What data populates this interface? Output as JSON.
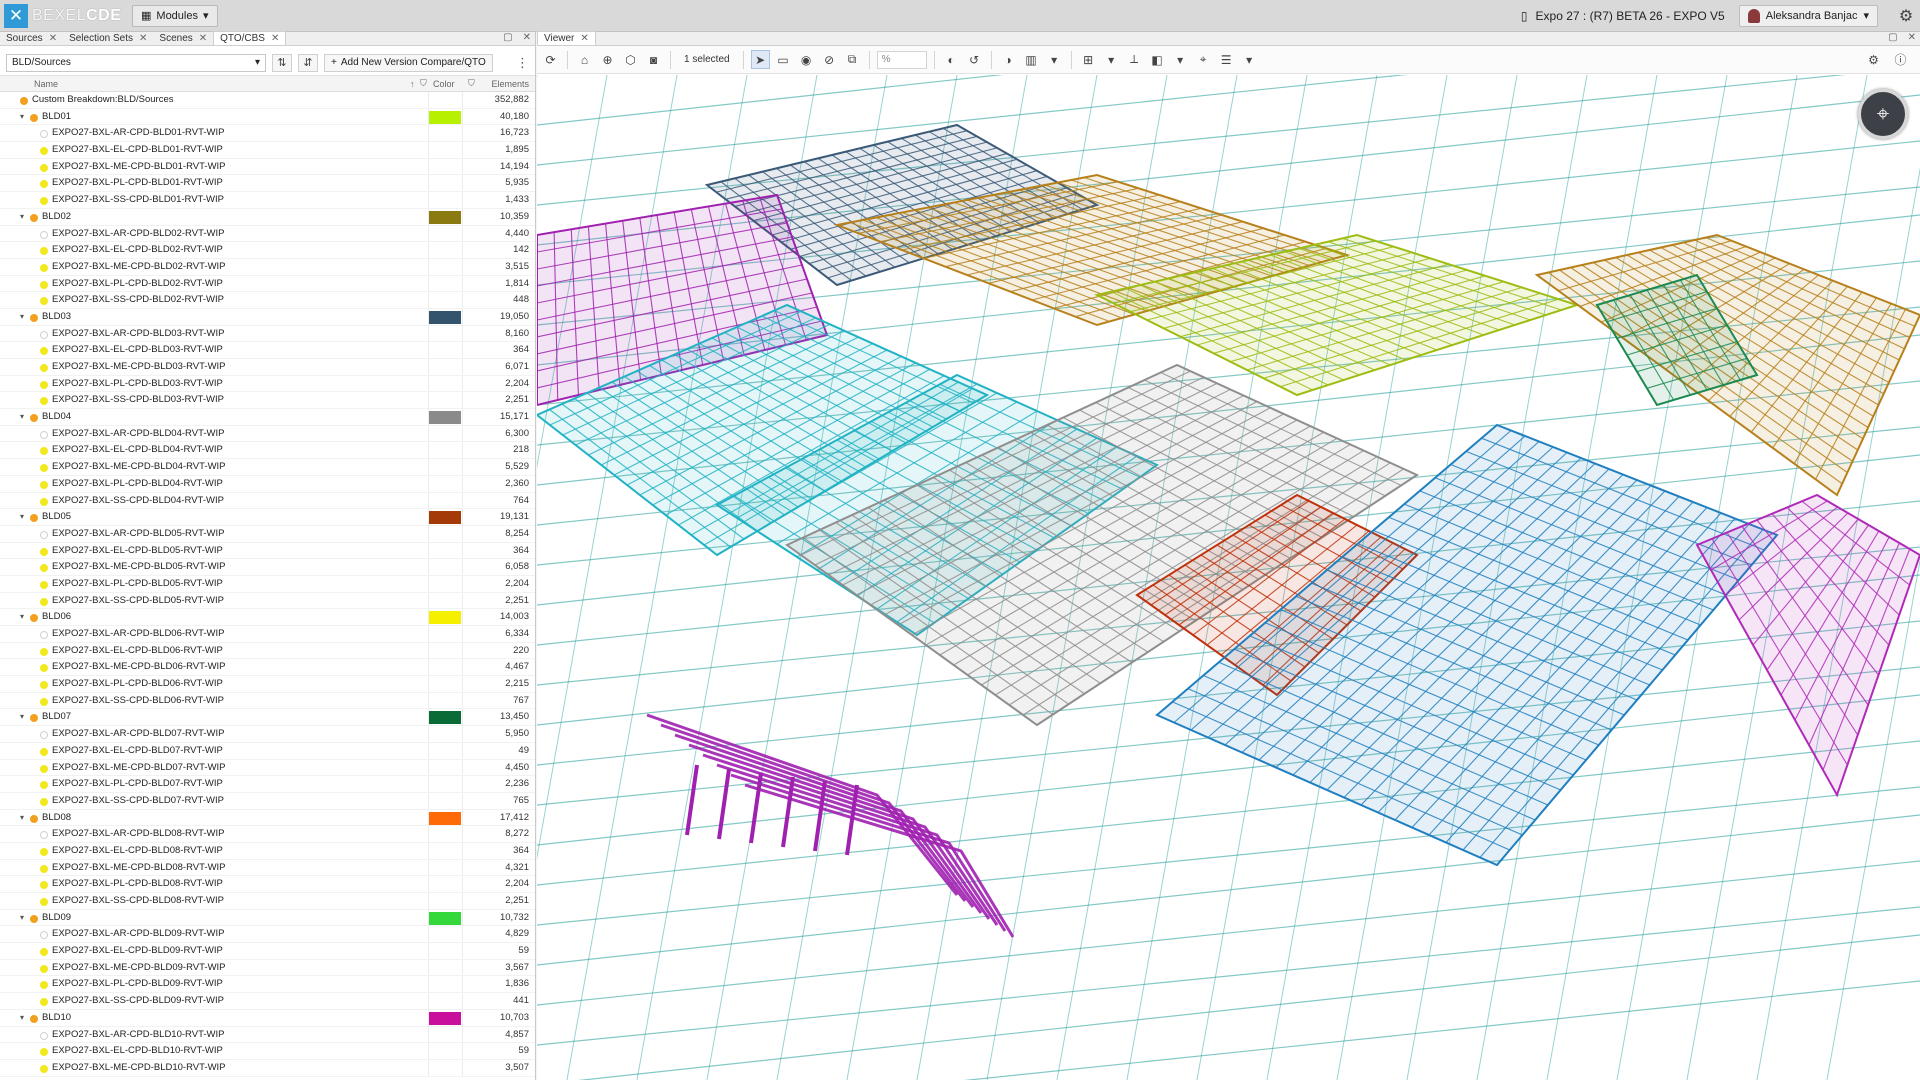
{
  "app": {
    "brand_prefix": "BEXEL",
    "brand_suffix": "CDE",
    "modules_label": "Modules"
  },
  "project": {
    "name": "Expo 27 : (R7) BETA 26 - EXPO V5"
  },
  "user": {
    "name": "Aleksandra Banjac"
  },
  "left_tabs": [
    {
      "label": "Sources"
    },
    {
      "label": "Selection Sets"
    },
    {
      "label": "Scenes"
    },
    {
      "label": "QTO/CBS"
    }
  ],
  "left_toolbar": {
    "breakdown_value": "BLD/Sources",
    "add_compare_label": "Add New Version Compare/QTO"
  },
  "columns": {
    "name": "Name",
    "color": "Color",
    "elements": "Elements"
  },
  "tree": {
    "root": {
      "label": "Custom Breakdown:BLD/Sources",
      "count": "352,882"
    },
    "groups": [
      {
        "label": "BLD01",
        "count": "40,180",
        "color": "#b7f000",
        "children": [
          {
            "label": "EXPO27-BXL-AR-CPD-BLD01-RVT-WIP",
            "count": "16,723"
          },
          {
            "label": "EXPO27-BXL-EL-CPD-BLD01-RVT-WIP",
            "count": "1,895"
          },
          {
            "label": "EXPO27-BXL-ME-CPD-BLD01-RVT-WIP",
            "count": "14,194"
          },
          {
            "label": "EXPO27-BXL-PL-CPD-BLD01-RVT-WIP",
            "count": "5,935"
          },
          {
            "label": "EXPO27-BXL-SS-CPD-BLD01-RVT-WIP",
            "count": "1,433"
          }
        ]
      },
      {
        "label": "BLD02",
        "count": "10,359",
        "color": "#8a7a10",
        "children": [
          {
            "label": "EXPO27-BXL-AR-CPD-BLD02-RVT-WIP",
            "count": "4,440"
          },
          {
            "label": "EXPO27-BXL-EL-CPD-BLD02-RVT-WIP",
            "count": "142"
          },
          {
            "label": "EXPO27-BXL-ME-CPD-BLD02-RVT-WIP",
            "count": "3,515"
          },
          {
            "label": "EXPO27-BXL-PL-CPD-BLD02-RVT-WIP",
            "count": "1,814"
          },
          {
            "label": "EXPO27-BXL-SS-CPD-BLD02-RVT-WIP",
            "count": "448"
          }
        ]
      },
      {
        "label": "BLD03",
        "count": "19,050",
        "color": "#34546e",
        "children": [
          {
            "label": "EXPO27-BXL-AR-CPD-BLD03-RVT-WIP",
            "count": "8,160"
          },
          {
            "label": "EXPO27-BXL-EL-CPD-BLD03-RVT-WIP",
            "count": "364"
          },
          {
            "label": "EXPO27-BXL-ME-CPD-BLD03-RVT-WIP",
            "count": "6,071"
          },
          {
            "label": "EXPO27-BXL-PL-CPD-BLD03-RVT-WIP",
            "count": "2,204"
          },
          {
            "label": "EXPO27-BXL-SS-CPD-BLD03-RVT-WIP",
            "count": "2,251"
          }
        ]
      },
      {
        "label": "BLD04",
        "count": "15,171",
        "color": "#8a8a8a",
        "children": [
          {
            "label": "EXPO27-BXL-AR-CPD-BLD04-RVT-WIP",
            "count": "6,300"
          },
          {
            "label": "EXPO27-BXL-EL-CPD-BLD04-RVT-WIP",
            "count": "218"
          },
          {
            "label": "EXPO27-BXL-ME-CPD-BLD04-RVT-WIP",
            "count": "5,529"
          },
          {
            "label": "EXPO27-BXL-PL-CPD-BLD04-RVT-WIP",
            "count": "2,360"
          },
          {
            "label": "EXPO27-BXL-SS-CPD-BLD04-RVT-WIP",
            "count": "764"
          }
        ]
      },
      {
        "label": "BLD05",
        "count": "19,131",
        "color": "#a33a08",
        "children": [
          {
            "label": "EXPO27-BXL-AR-CPD-BLD05-RVT-WIP",
            "count": "8,254"
          },
          {
            "label": "EXPO27-BXL-EL-CPD-BLD05-RVT-WIP",
            "count": "364"
          },
          {
            "label": "EXPO27-BXL-ME-CPD-BLD05-RVT-WIP",
            "count": "6,058"
          },
          {
            "label": "EXPO27-BXL-PL-CPD-BLD05-RVT-WIP",
            "count": "2,204"
          },
          {
            "label": "EXPO27-BXL-SS-CPD-BLD05-RVT-WIP",
            "count": "2,251"
          }
        ]
      },
      {
        "label": "BLD06",
        "count": "14,003",
        "color": "#f5f000",
        "children": [
          {
            "label": "EXPO27-BXL-AR-CPD-BLD06-RVT-WIP",
            "count": "6,334"
          },
          {
            "label": "EXPO27-BXL-EL-CPD-BLD06-RVT-WIP",
            "count": "220"
          },
          {
            "label": "EXPO27-BXL-ME-CPD-BLD06-RVT-WIP",
            "count": "4,467"
          },
          {
            "label": "EXPO27-BXL-PL-CPD-BLD06-RVT-WIP",
            "count": "2,215"
          },
          {
            "label": "EXPO27-BXL-SS-CPD-BLD06-RVT-WIP",
            "count": "767"
          }
        ]
      },
      {
        "label": "BLD07",
        "count": "13,450",
        "color": "#0b6b36",
        "children": [
          {
            "label": "EXPO27-BXL-AR-CPD-BLD07-RVT-WIP",
            "count": "5,950"
          },
          {
            "label": "EXPO27-BXL-EL-CPD-BLD07-RVT-WIP",
            "count": "49"
          },
          {
            "label": "EXPO27-BXL-ME-CPD-BLD07-RVT-WIP",
            "count": "4,450"
          },
          {
            "label": "EXPO27-BXL-PL-CPD-BLD07-RVT-WIP",
            "count": "2,236"
          },
          {
            "label": "EXPO27-BXL-SS-CPD-BLD07-RVT-WIP",
            "count": "765"
          }
        ]
      },
      {
        "label": "BLD08",
        "count": "17,412",
        "color": "#ff6a08",
        "children": [
          {
            "label": "EXPO27-BXL-AR-CPD-BLD08-RVT-WIP",
            "count": "8,272"
          },
          {
            "label": "EXPO27-BXL-EL-CPD-BLD08-RVT-WIP",
            "count": "364"
          },
          {
            "label": "EXPO27-BXL-ME-CPD-BLD08-RVT-WIP",
            "count": "4,321"
          },
          {
            "label": "EXPO27-BXL-PL-CPD-BLD08-RVT-WIP",
            "count": "2,204"
          },
          {
            "label": "EXPO27-BXL-SS-CPD-BLD08-RVT-WIP",
            "count": "2,251"
          }
        ]
      },
      {
        "label": "BLD09",
        "count": "10,732",
        "color": "#35d83a",
        "children": [
          {
            "label": "EXPO27-BXL-AR-CPD-BLD09-RVT-WIP",
            "count": "4,829"
          },
          {
            "label": "EXPO27-BXL-EL-CPD-BLD09-RVT-WIP",
            "count": "59"
          },
          {
            "label": "EXPO27-BXL-ME-CPD-BLD09-RVT-WIP",
            "count": "3,567"
          },
          {
            "label": "EXPO27-BXL-PL-CPD-BLD09-RVT-WIP",
            "count": "1,836"
          },
          {
            "label": "EXPO27-BXL-SS-CPD-BLD09-RVT-WIP",
            "count": "441"
          }
        ]
      },
      {
        "label": "BLD10",
        "count": "10,703",
        "color": "#c8109c",
        "children": [
          {
            "label": "EXPO27-BXL-AR-CPD-BLD10-RVT-WIP",
            "count": "4,857"
          },
          {
            "label": "EXPO27-BXL-EL-CPD-BLD10-RVT-WIP",
            "count": "59"
          },
          {
            "label": "EXPO27-BXL-ME-CPD-BLD10-RVT-WIP",
            "count": "3,507"
          }
        ]
      }
    ]
  },
  "viewer": {
    "tab_label": "Viewer",
    "selected_text": "1 selected",
    "percent_placeholder": "%"
  },
  "model_colors": {
    "teal": "#1f9c98",
    "cyan": "#21b3c4",
    "navy": "#3b5a78",
    "ochre": "#b7801a",
    "lime": "#9dbd12",
    "grey": "#8e8e8e",
    "red": "#c0300a",
    "blue": "#1f7fc0",
    "purple": "#a020b0",
    "magenta": "#b02ab8",
    "green": "#1a8a50"
  }
}
